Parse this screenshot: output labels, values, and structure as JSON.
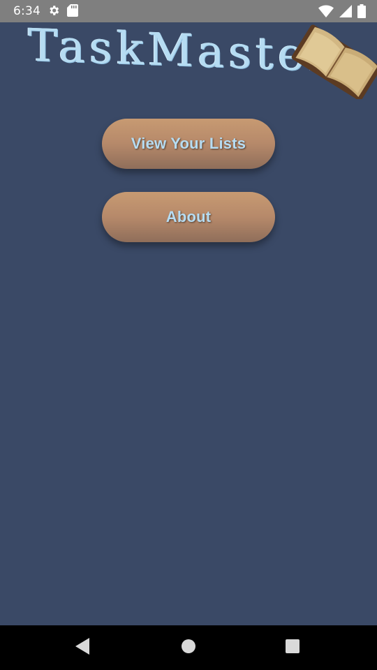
{
  "status_bar": {
    "time": "6:34",
    "icons": [
      "gear-icon",
      "sd-card-icon",
      "wifi-icon",
      "signal-icon",
      "battery-icon"
    ]
  },
  "app": {
    "title": "TaskMaster",
    "logo_icon": "open-book-icon",
    "buttons": {
      "view_lists": "View Your Lists",
      "about": "About"
    }
  },
  "nav_bar": {
    "icons": [
      "back-triangle-icon",
      "home-circle-icon",
      "recents-square-icon"
    ]
  },
  "colors": {
    "background": "#3a4966",
    "status_bar": "#7f7f7f",
    "button_top": "#c79a72",
    "button_bottom": "#8f6e5a",
    "button_text": "#b6dcf2",
    "nav_bar": "#000000"
  }
}
